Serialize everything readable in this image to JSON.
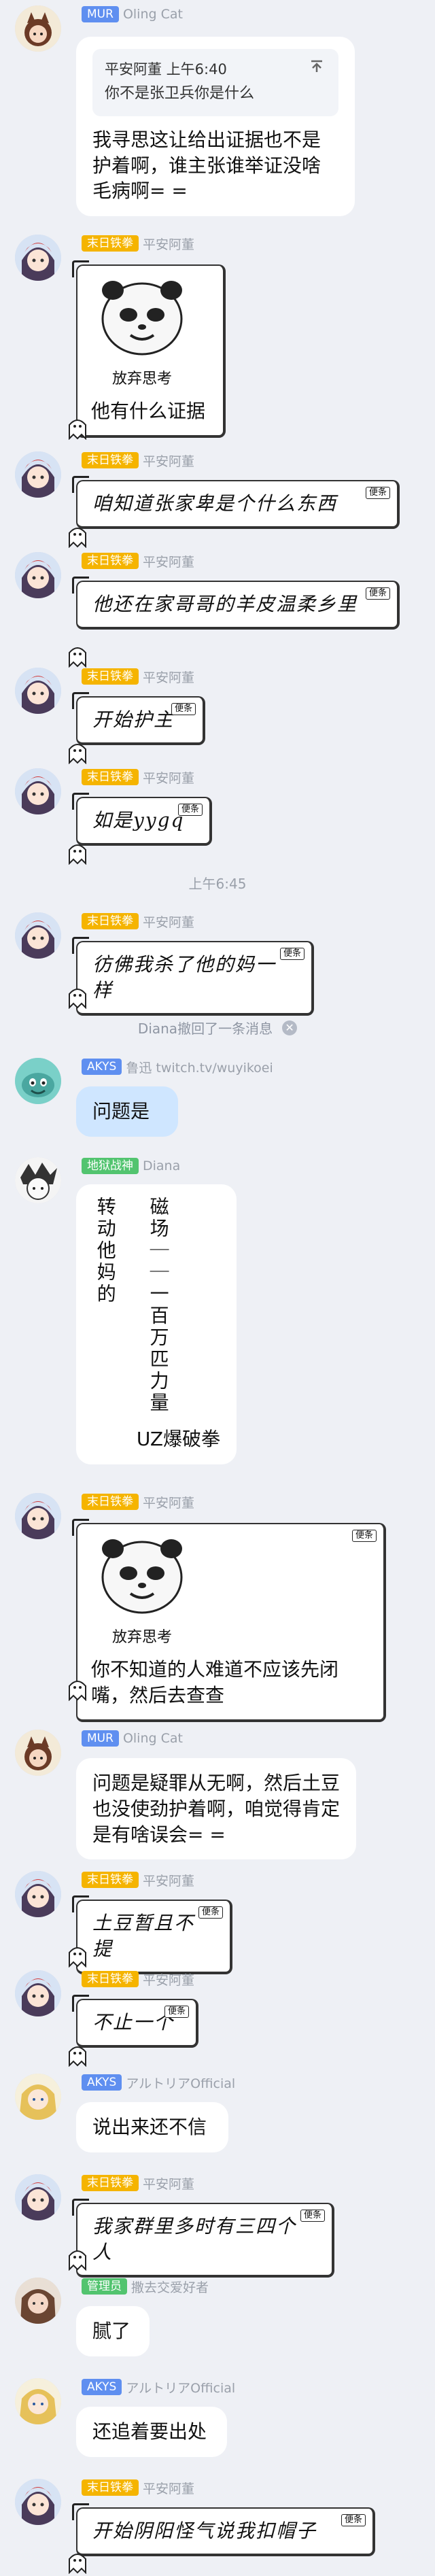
{
  "messages": [
    {
      "badge": "MUR",
      "nick": "Oling Cat",
      "quote_sender": "平安阿董 上午6:40",
      "quote_text": "你不是张卫兵你是什么",
      "text": "我寻思这让给出证据也不是护着啊，谁主张谁举证没啥毛病啊= ="
    },
    {
      "badge": "末日铁拳",
      "nick": "平安阿董",
      "meme_caption": "放弃思考",
      "text": "他有什么证据"
    },
    {
      "badge": "末日铁拳",
      "nick": "平安阿董",
      "tag": "便条",
      "text": "咱知道张家卑是个什么东西"
    },
    {
      "badge": "末日铁拳",
      "nick": "平安阿董",
      "tag": "便条",
      "text": "他还在家哥哥的羊皮温柔乡里"
    },
    {
      "badge": "末日铁拳",
      "nick": "平安阿董",
      "tag": "便条",
      "text": "开始护主"
    },
    {
      "badge": "末日铁拳",
      "nick": "平安阿董",
      "tag": "便条",
      "text": "如是yygq"
    },
    {
      "badge": "末日铁拳",
      "nick": "平安阿董",
      "tag": "便条",
      "text": "彷佛我杀了他的妈一样"
    },
    {
      "badge": "AKYS",
      "nick": "鲁迅 twitch.tv/wuyikoei",
      "text": "问题是"
    },
    {
      "badge": "地狱战神",
      "nick": "Diana",
      "vcol1": "磁场｜｜一百万匹力量",
      "vcol2": "转动他妈的",
      "text": "UZ爆破拳"
    },
    {
      "badge": "末日铁拳",
      "nick": "平安阿董",
      "tag": "便条",
      "meme_caption": "放弃思考",
      "text": "你不知道的人难道不应该先闭嘴，然后去查查"
    },
    {
      "badge": "MUR",
      "nick": "Oling Cat",
      "text": "问题是疑罪从无啊，然后土豆也没使劲护着啊，咱觉得肯定是有啥误会= ="
    },
    {
      "badge": "末日铁拳",
      "nick": "平安阿董",
      "tag": "便条",
      "text": "土豆暂且不提"
    },
    {
      "badge": "末日铁拳",
      "nick": "平安阿董",
      "tag": "便条",
      "text": "不止一个"
    },
    {
      "badge": "AKYS",
      "nick": "アルトリアOfficial",
      "text": "说出来还不信"
    },
    {
      "badge": "末日铁拳",
      "nick": "平安阿董",
      "tag": "便条",
      "text": "我家群里多时有三四个人"
    },
    {
      "badge": "管理员",
      "nick": "撒去交爱好者",
      "text": "腻了"
    },
    {
      "badge": "AKYS",
      "nick": "アルトリアOfficial",
      "text": "还追着要出处"
    },
    {
      "badge": "末日铁拳",
      "nick": "平安阿董",
      "tag": "便条",
      "text": "开始阴阳怪气说我扣帽子"
    }
  ],
  "time_divider": "上午6:45",
  "system_notice": "Diana撤回了一条消息",
  "system_notice_close": "✕",
  "colors": {
    "background": "#eef0f5",
    "badge_yellow": "#f5b400",
    "badge_blue": "#5f8ff0",
    "badge_green": "#52c46f",
    "bubble_blue": "#cfe6ff"
  }
}
